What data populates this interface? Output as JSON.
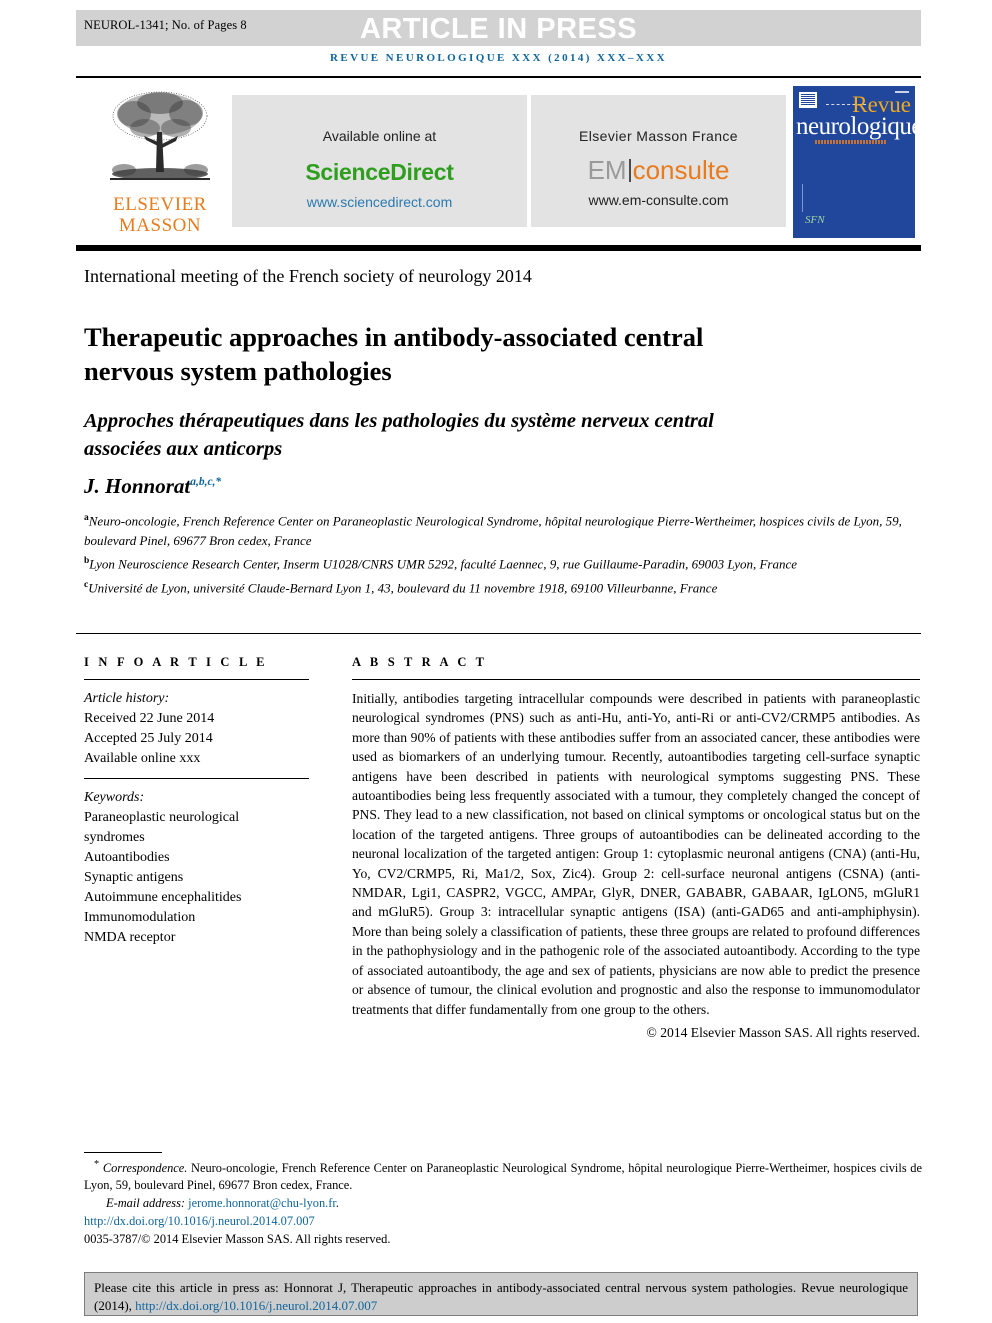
{
  "banner": {
    "running_head": "NEUROL-1341; No. of Pages 8",
    "press_title": "ARTICLE IN PRESS",
    "banner_color": "#d2d2d2"
  },
  "journal_line": "REVUE NEUROLOGIQUE XXX (2014) XXX–XXX",
  "masthead": {
    "publisher_line1": "ELSEVIER",
    "publisher_line2": "MASSON",
    "sciencedirect": {
      "available_label": "Available online at",
      "name": "ScienceDirect",
      "url": "www.sciencedirect.com",
      "name_color": "#2f9e1f",
      "url_color": "#2a7ab0"
    },
    "emconsulte": {
      "top_label": "Elsevier Masson France",
      "logo_left": "EM",
      "logo_right": "consulte",
      "url": "www.em-consulte.com",
      "logo_color": "#e87b1e"
    },
    "cover": {
      "title_top": "Revue",
      "title_bottom": "neurologique",
      "background": "#20479b",
      "title_top_color": "#f0a81e"
    }
  },
  "article": {
    "meeting": "International meeting of the French society of neurology 2014",
    "title_en": "Therapeutic approaches in antibody-associated central nervous system pathologies",
    "title_fr": "Approches thérapeutiques dans les pathologies du système nerveux central associées aux anticorps",
    "author_name": "J. Honnorat",
    "author_marks": "a,b,c,*",
    "affiliations": [
      {
        "mark": "a",
        "text": "Neuro-oncologie, French Reference Center on Paraneoplastic Neurological Syndrome, hôpital neurologique Pierre-Wertheimer, hospices civils de Lyon, 59, boulevard Pinel, 69677 Bron cedex, France"
      },
      {
        "mark": "b",
        "text": "Lyon Neuroscience Research Center, Inserm U1028/CNRS UMR 5292, faculté Laennec, 9, rue Guillaume-Paradin, 69003 Lyon, France"
      },
      {
        "mark": "c",
        "text": "Université de Lyon, université Claude-Bernard Lyon 1, 43, boulevard du 11 novembre 1918, 69100 Villeurbanne, France"
      }
    ]
  },
  "info": {
    "section_label": "I N F O   A R T I C L E",
    "history_title": "Article history:",
    "history": [
      "Received 22 June 2014",
      "Accepted 25 July 2014",
      "Available online xxx"
    ],
    "keywords_title": "Keywords:",
    "keywords": [
      "Paraneoplastic neurological",
      "syndromes",
      "Autoantibodies",
      "Synaptic antigens",
      "Autoimmune encephalitides",
      "Immunomodulation",
      "NMDA receptor"
    ]
  },
  "abstract": {
    "section_label": "A B S T R A C T",
    "body": "Initially, antibodies targeting intracellular compounds were described in patients with paraneoplastic neurological syndromes (PNS) such as anti-Hu, anti-Yo, anti-Ri or anti-CV2/CRMP5 antibodies. As more than 90% of patients with these antibodies suffer from an associated cancer, these antibodies were used as biomarkers of an underlying tumour. Recently, autoantibodies targeting cell-surface synaptic antigens have been described in patients with neurological symptoms suggesting PNS. These autoantibodies being less frequently associated with a tumour, they completely changed the concept of PNS. They lead to a new classification, not based on clinical symptoms or oncological status but on the location of the targeted antigens. Three groups of autoantibodies can be delineated according to the neuronal localization of the targeted antigen: Group 1: cytoplasmic neuronal antigens (CNA) (anti-Hu, Yo, CV2/CRMP5, Ri, Ma1/2, Sox, Zic4). Group 2: cell-surface neuronal antigens (CSNA) (anti-NMDAR, Lgi1, CASPR2, VGCC, AMPAr, GlyR, DNER, GABABR, GABAAR, IgLON5, mGluR1 and mGluR5). Group 3: intracellular synaptic antigens (ISA) (anti-GAD65 and anti-amphiphysin). More than being solely a classification of patients, these three groups are related to profound differences in the pathophysiology and in the pathogenic role of the associated autoantibody. According to the type of associated autoantibody, the age and sex of patients, physicians are now able to predict the presence or absence of tumour, the clinical evolution and prognostic and also the response to immunomodulator treatments that differ fundamentally from one group to the others.",
    "copyright": "© 2014 Elsevier Masson SAS. All rights reserved."
  },
  "footnote": {
    "corr_mark": "*",
    "corr_label": "Correspondence.",
    "corr_text": "Neuro-oncologie, French Reference Center on Paraneoplastic Neurological Syndrome, hôpital neurologique Pierre-Wertheimer, hospices civils de Lyon, 59, boulevard Pinel, 69677 Bron cedex, France.",
    "email_label": "E-mail address:",
    "email": "jerome.honnorat@chu-lyon.fr",
    "doi": "http://dx.doi.org/10.1016/j.neurol.2014.07.007",
    "issn_line": "0035-3787/© 2014 Elsevier Masson SAS. All rights reserved.",
    "link_color": "#10659c"
  },
  "citation_box": {
    "text": "Please cite this article in press as: Honnorat J, Therapeutic approaches in antibody-associated central nervous system pathologies. Revue neurologique (2014),",
    "link": "http://dx.doi.org/10.1016/j.neurol.2014.07.007",
    "background": "#cdcdcd"
  }
}
